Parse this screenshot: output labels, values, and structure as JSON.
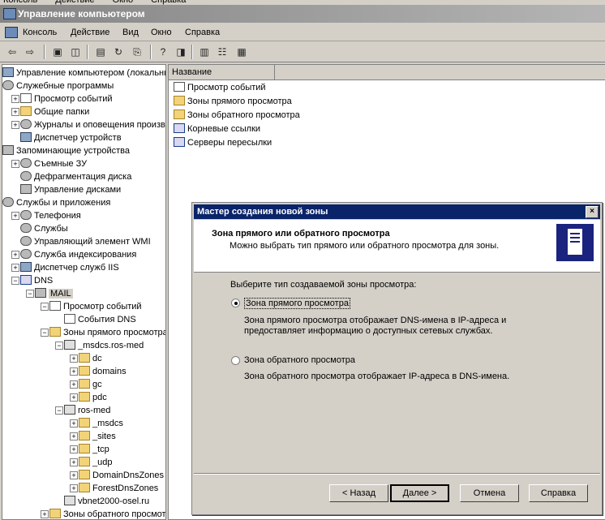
{
  "top_menu_partial": [
    "Консоль",
    "Действие",
    "Окно",
    "Справка"
  ],
  "window": {
    "title": "Управление компьютером"
  },
  "menubar": [
    {
      "label": "Консоль",
      "u": "К"
    },
    {
      "label": "Действие",
      "u": "Д"
    },
    {
      "label": "Вид",
      "u": "В"
    },
    {
      "label": "Окно",
      "u": "О"
    },
    {
      "label": "Справка",
      "u": "С"
    }
  ],
  "toolbar_icons": [
    "back-icon",
    "forward-icon",
    "up-folder-icon",
    "show-hide-tree-icon",
    "properties-icon",
    "refresh-icon",
    "export-list-icon",
    "help-icon",
    "show-hide-action-pane-icon",
    "list-view-icon",
    "details-icon",
    "large-icons-icon"
  ],
  "tree": {
    "items": [
      {
        "label": "Управление компьютером (локальным)",
        "depth": 0,
        "icon": "comp",
        "pm": ""
      },
      {
        "label": "Служебные программы",
        "depth": 0,
        "icon": "gear",
        "pm": "-"
      },
      {
        "label": "Просмотр событий",
        "depth": 1,
        "icon": "evt",
        "pm": "+"
      },
      {
        "label": "Общие папки",
        "depth": 1,
        "icon": "folder",
        "pm": "+"
      },
      {
        "label": "Журналы и оповещения произв",
        "depth": 1,
        "icon": "gear",
        "pm": "+"
      },
      {
        "label": "Диспетчер устройств",
        "depth": 1,
        "icon": "comp",
        "pm": ""
      },
      {
        "label": "Запоминающие устройства",
        "depth": 0,
        "icon": "srv",
        "pm": "-"
      },
      {
        "label": "Съемные ЗУ",
        "depth": 1,
        "icon": "gear",
        "pm": "+"
      },
      {
        "label": "Дефрагментация диска",
        "depth": 1,
        "icon": "gear",
        "pm": ""
      },
      {
        "label": "Управление дисками",
        "depth": 1,
        "icon": "srv",
        "pm": ""
      },
      {
        "label": "Службы и приложения",
        "depth": 0,
        "icon": "gear",
        "pm": "-"
      },
      {
        "label": "Телефония",
        "depth": 1,
        "icon": "gear",
        "pm": "+"
      },
      {
        "label": "Службы",
        "depth": 1,
        "icon": "gear",
        "pm": ""
      },
      {
        "label": "Управляющий элемент WMI",
        "depth": 1,
        "icon": "gear",
        "pm": ""
      },
      {
        "label": "Служба индексирования",
        "depth": 1,
        "icon": "gear",
        "pm": "+"
      },
      {
        "label": "Диспетчер служб IIS",
        "depth": 1,
        "icon": "comp",
        "pm": "+"
      },
      {
        "label": "DNS",
        "depth": 1,
        "icon": "dnsico",
        "pm": "-"
      },
      {
        "label": "MAIL",
        "depth": 2,
        "icon": "srv",
        "pm": "-"
      },
      {
        "label": "Просмотр событий",
        "depth": 3,
        "icon": "evt",
        "pm": "-"
      },
      {
        "label": "События DNS",
        "depth": 4,
        "icon": "evt",
        "pm": ""
      },
      {
        "label": "Зоны прямого просмотра",
        "depth": 3,
        "icon": "folder",
        "pm": "-"
      },
      {
        "label": "_msdcs.ros-med",
        "depth": 4,
        "icon": "dnsz",
        "pm": "-"
      },
      {
        "label": "dc",
        "depth": 5,
        "icon": "folder",
        "pm": "+"
      },
      {
        "label": "domains",
        "depth": 5,
        "icon": "folder",
        "pm": "+"
      },
      {
        "label": "gc",
        "depth": 5,
        "icon": "folder",
        "pm": "+"
      },
      {
        "label": "pdc",
        "depth": 5,
        "icon": "folder",
        "pm": "+"
      },
      {
        "label": "ros-med",
        "depth": 4,
        "icon": "dnsz",
        "pm": "-"
      },
      {
        "label": "_msdcs",
        "depth": 5,
        "icon": "folder",
        "pm": "+"
      },
      {
        "label": "_sites",
        "depth": 5,
        "icon": "folder",
        "pm": "+"
      },
      {
        "label": "_tcp",
        "depth": 5,
        "icon": "folder",
        "pm": "+"
      },
      {
        "label": "_udp",
        "depth": 5,
        "icon": "folder",
        "pm": "+"
      },
      {
        "label": "DomainDnsZones",
        "depth": 5,
        "icon": "folder",
        "pm": "+"
      },
      {
        "label": "ForestDnsZones",
        "depth": 5,
        "icon": "folder",
        "pm": "+"
      },
      {
        "label": "vbnet2000-osel.ru",
        "depth": 4,
        "icon": "dnsz",
        "pm": ""
      },
      {
        "label": "Зоны обратного просмот",
        "depth": 3,
        "icon": "folder",
        "pm": "+"
      }
    ]
  },
  "list": {
    "column_header": "Название",
    "rows": [
      {
        "label": "Просмотр событий",
        "icon": "evt"
      },
      {
        "label": "Зоны прямого просмотра",
        "icon": "folder"
      },
      {
        "label": "Зоны обратного просмотра",
        "icon": "folder"
      },
      {
        "label": "Корневые ссылки",
        "icon": "dnsico"
      },
      {
        "label": "Серверы пересылки",
        "icon": "dnsico"
      }
    ]
  },
  "wizard": {
    "title": "Мастер создания новой зоны",
    "close": "×",
    "heading": "Зона прямого или обратного просмотра",
    "subheading": "Можно выбрать тип прямого или обратного просмотра для зоны.",
    "prompt": "Выберите тип создаваемой зоны просмотра:",
    "options": [
      {
        "label": "Зона прямого просмотра",
        "selected": true,
        "desc1": "Зона прямого просмотра отображает DNS-имена в IP-адреса и",
        "desc2": "предоставляет информацию о доступных сетевых службах."
      },
      {
        "label": "Зона обратного просмотра",
        "selected": false,
        "desc1": "Зона обратного просмотра отображает IP-адреса в DNS-имена.",
        "desc2": ""
      }
    ],
    "buttons": {
      "back": "< Назад",
      "next": "Далее >",
      "cancel": "Отмена",
      "help": "Справка"
    }
  }
}
